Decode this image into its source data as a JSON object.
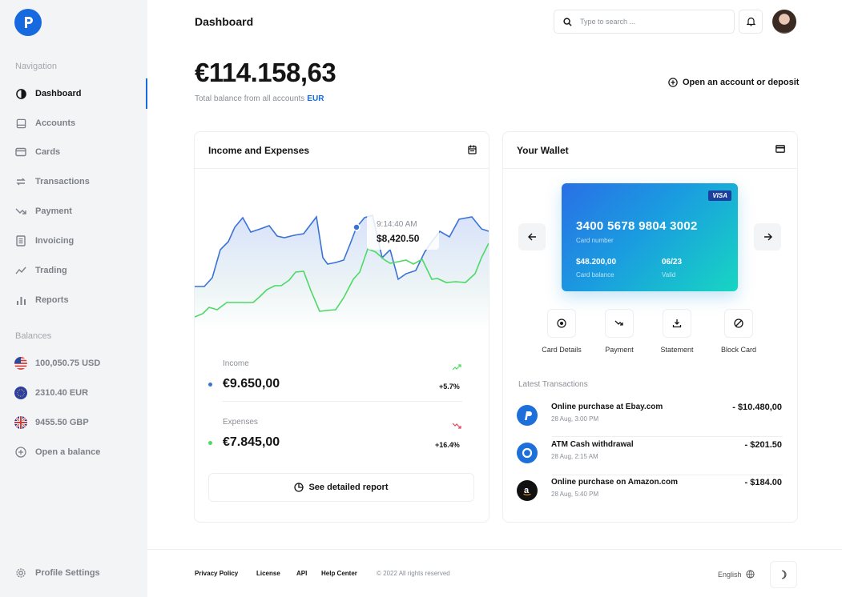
{
  "sidebar": {
    "nav_heading": "Navigation",
    "items": [
      {
        "label": "Dashboard",
        "icon": "dashboard-icon",
        "active": true
      },
      {
        "label": "Accounts",
        "icon": "accounts-icon"
      },
      {
        "label": "Cards",
        "icon": "card-icon"
      },
      {
        "label": "Transactions",
        "icon": "transfer-icon"
      },
      {
        "label": "Payment",
        "icon": "payment-icon"
      },
      {
        "label": "Invoicing",
        "icon": "invoice-icon"
      },
      {
        "label": "Trading",
        "icon": "trading-icon"
      },
      {
        "label": "Reports",
        "icon": "reports-icon"
      }
    ],
    "balances_heading": "Balances",
    "balances": [
      {
        "label": "100,050.75 USD",
        "flag": "us-flag-icon"
      },
      {
        "label": "2310.40 EUR",
        "flag": "eu-flag-icon"
      },
      {
        "label": "9455.50 GBP",
        "flag": "uk-flag-icon"
      }
    ],
    "open_balance": "Open a balance",
    "profile_settings": "Profile Settings"
  },
  "header": {
    "title": "Dashboard",
    "search_placeholder": "Type to search ..."
  },
  "summary": {
    "total": "€114.158,63",
    "total_label": "Total balance from all accounts",
    "currency": "EUR",
    "open_account": "Open an account or deposit"
  },
  "income_card": {
    "title": "Income and Expenses",
    "tooltip_time": "9:14:40 AM",
    "tooltip_value": "$8,420.50",
    "income_label": "Income",
    "income_value": "€9.650,00",
    "income_change": "+5.7%",
    "expenses_label": "Expenses",
    "expenses_value": "€7.845,00",
    "expenses_change": "+16.4%",
    "report_button": "See detailed report"
  },
  "wallet": {
    "title": "Your Wallet",
    "card_brand": "VISA",
    "card_number": "3400 5678 9804 3002",
    "card_number_label": "Card number",
    "card_balance": "$48.200,00",
    "card_balance_label": "Card balance",
    "valid": "06/23",
    "valid_label": "Valid",
    "actions": [
      "Card Details",
      "Payment",
      "Statement",
      "Block Card"
    ],
    "latest_label": "Latest Transactions",
    "transactions": [
      {
        "title": "Online purchase at Ebay.com",
        "date": "28 Aug, 3:00 PM",
        "amount": "- $10.480,00",
        "icon": "paypal-icon"
      },
      {
        "title": "ATM Cash withdrawal",
        "date": "28 Aug, 2:15 AM",
        "amount": "- $201.50",
        "icon": "bank-icon"
      },
      {
        "title": "Online purchase on Amazon.com",
        "date": "28 Aug, 5:40 PM",
        "amount": "- $184.00",
        "icon": "amazon-icon"
      }
    ]
  },
  "footer": {
    "links": [
      "Privacy Policy",
      "License",
      "API",
      "Help Center"
    ],
    "copyright": "© 2022 All rights reserved",
    "language": "English"
  },
  "colors": {
    "accent": "#1769e0",
    "income_line": "#3a73d6",
    "expense_line": "#4cd964"
  }
}
